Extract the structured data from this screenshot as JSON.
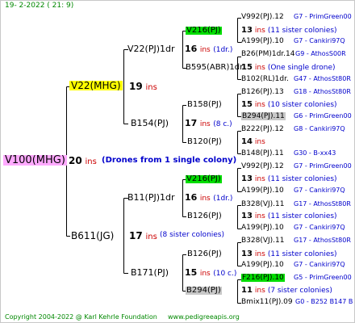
{
  "header": {
    "date": "19-  2-2022 ( 21:  9)"
  },
  "footer": {
    "copyright": "Copyright 2004-2022 @ Karl Kehrle Foundation",
    "site": "www.pedigreeapis.org"
  },
  "root": {
    "name": "V100(MHG)",
    "count": "20",
    "ins": "ins",
    "note": "(Drones from 1 single colony)"
  },
  "gen1": {
    "top": {
      "name": "V22(MHG)",
      "count": "19",
      "ins": "ins"
    },
    "bottom": {
      "name": "B611(JG)",
      "count": "17",
      "ins": "ins",
      "note": "(8 sister colonies)"
    }
  },
  "gen2": {
    "a": {
      "name": "V22(PJ)1dr",
      "count": "16",
      "ins": "ins",
      "note": "(1dr.)"
    },
    "b": {
      "name": "B154(PJ)",
      "count": "17",
      "ins": "ins",
      "note": "(8 c.)"
    },
    "c": {
      "name": "B11(PJ)1dr",
      "count": "16",
      "ins": "ins",
      "note": "(1dr.)"
    },
    "d": {
      "name": "B171(PJ)",
      "count": "15",
      "ins": "ins",
      "note": "(10 c.)"
    }
  },
  "gen3": {
    "a1": "V216(PJ)",
    "a2": "B595(ABR)1dr",
    "b1": "B158(PJ)",
    "b2": "B120(PJ)",
    "c1": "V216(PJ)",
    "c2": "B126(PJ)",
    "d1": "B126(PJ)",
    "d2": "B294(PJ)"
  },
  "gen4": [
    {
      "name": "V992(PJ).12",
      "code": "G7 - PrimGreen00"
    },
    {
      "count": "13",
      "ins": "ins",
      "note": "(11 sister colonies)"
    },
    {
      "name": "A199(PJ).10",
      "code": "G7 - Cankiri97Q"
    },
    {
      "name": "B26(PM)1dr.14",
      "code": "G9 - AthosS00R"
    },
    {
      "count": "15",
      "ins": "ins",
      "note": "(One single drone)"
    },
    {
      "name": "B102(RL)1dr.",
      "code": "G47 - AthosSt80R"
    },
    {
      "name": "B126(PJ).13",
      "code": "G18 - AthosSt80R"
    },
    {
      "count": "15",
      "ins": "ins",
      "note": "(10 sister colonies)"
    },
    {
      "name": "B294(PJ).11",
      "code": "G6 - PrimGreen00"
    },
    {
      "name": "B222(PJ).12",
      "code": "G8 - Cankiri97Q"
    },
    {
      "count": "14",
      "ins": "ins",
      "note": ""
    },
    {
      "name": "B148(PJ).11",
      "code": "G30 - B-xx43"
    },
    {
      "name": "V992(PJ).12",
      "code": "G7 - PrimGreen00"
    },
    {
      "count": "13",
      "ins": "ins",
      "note": "(11 sister colonies)"
    },
    {
      "name": "A199(PJ).10",
      "code": "G7 - Cankiri97Q"
    },
    {
      "name": "B328(VJ).11",
      "code": "G17 - AthosSt80R"
    },
    {
      "count": "13",
      "ins": "ins",
      "note": "(11 sister colonies)"
    },
    {
      "name": "A199(PJ).10",
      "code": "G7 - Cankiri97Q"
    },
    {
      "name": "B328(VJ).11",
      "code": "G17 - AthosSt80R"
    },
    {
      "count": "13",
      "ins": "ins",
      "note": "(11 sister colonies)"
    },
    {
      "name": "A199(PJ).10",
      "code": "G7 - Cankiri97Q"
    },
    {
      "name": "F216(PJ).10",
      "code": "G5 - PrimGreen00"
    },
    {
      "count": "11",
      "ins": "ins",
      "note": "(7 sister colonies)"
    },
    {
      "name": "Bmix11(PJ).09",
      "code": "G0 - B252 B147 B"
    }
  ]
}
